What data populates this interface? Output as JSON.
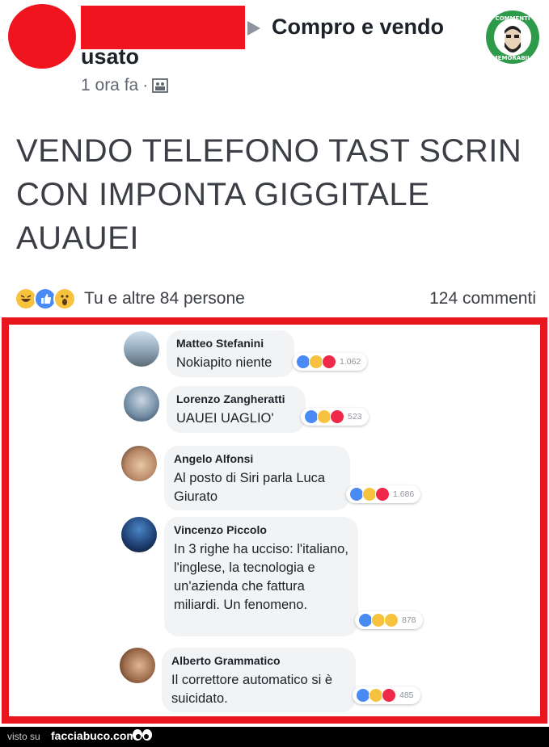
{
  "post": {
    "group_line1": "Compro e vendo",
    "group_line2": "usato",
    "time": "1 ora fa",
    "text": "VENDO TELEFONO TAST SCRIN CON IMPONTA GIGGITALE AUAUEI",
    "reactions_people": "Tu e altre 84 persone",
    "comments_count": "124 commenti"
  },
  "comments": [
    {
      "author": "Matteo Stefanini",
      "text": "Nokiapito niente",
      "reactions": [
        "like",
        "haha",
        "love"
      ],
      "count": "1.062"
    },
    {
      "author": "Lorenzo Zangheratti",
      "text": "UAUEI UAGLIO'",
      "reactions": [
        "like",
        "haha",
        "love"
      ],
      "count": "523"
    },
    {
      "author": "Angelo Alfonsi",
      "text": "Al posto di Siri parla Luca Giurato",
      "reactions": [
        "like",
        "haha",
        "love"
      ],
      "count": "1.686"
    },
    {
      "author": "Vincenzo Piccolo",
      "text": "In 3 righe ha ucciso: l'italiano, l'inglese, la tecnologia e un'azienda che fattura miliardi. Un fenomeno.",
      "reactions": [
        "like",
        "haha",
        "wow"
      ],
      "count": "878"
    },
    {
      "author": "Alberto Grammatico",
      "text": "Il correttore automatico si è suicidato.",
      "reactions": [
        "like",
        "haha",
        "love"
      ],
      "count": "485"
    }
  ],
  "footer": {
    "visto_su": "visto su",
    "site": "facciabuco.com"
  },
  "colors": {
    "highlight_red": "#e8141e",
    "like_blue": "#4a8af4",
    "love_red": "#f0284a",
    "haha_yellow": "#f7c33e"
  }
}
